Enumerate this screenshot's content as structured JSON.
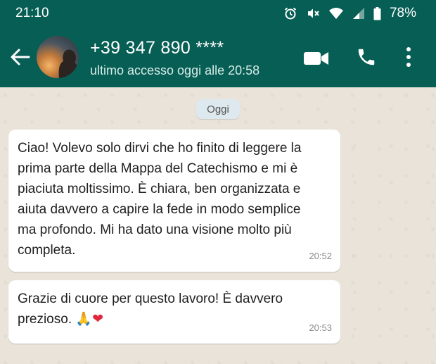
{
  "status_bar": {
    "time": "21:10",
    "battery": "78%"
  },
  "header": {
    "contact_name": "+39 347 890 ****",
    "contact_status": "ultimo accesso oggi alle 20:58"
  },
  "chat": {
    "date_chip": "Oggi",
    "messages": [
      {
        "text": "Ciao! Volevo solo dirvi che ho finito di leggere la\nprima parte della Mappa del Catechismo e mi è\npiaciuta moltissimo. È chiara, ben organizzata e\naiuta davvero a capire la fede in modo semplice\nma profondo. Mi ha dato una visione molto più\ncompleta.",
        "time": "20:52"
      },
      {
        "text": "Grazie di cuore per questo lavoro! È davvero\nprezioso.",
        "emoji_1": "🙏",
        "emoji_2": "❤",
        "time": "20:53"
      }
    ]
  },
  "colors": {
    "header_bg": "#075e54",
    "chat_bg": "#e9e3d9",
    "bubble_bg": "#ffffff"
  },
  "icons": [
    "alarm-icon",
    "mute-icon",
    "wifi-icon",
    "signal-icon",
    "battery-icon",
    "back-arrow-icon",
    "video-call-icon",
    "phone-icon",
    "more-options-icon"
  ]
}
